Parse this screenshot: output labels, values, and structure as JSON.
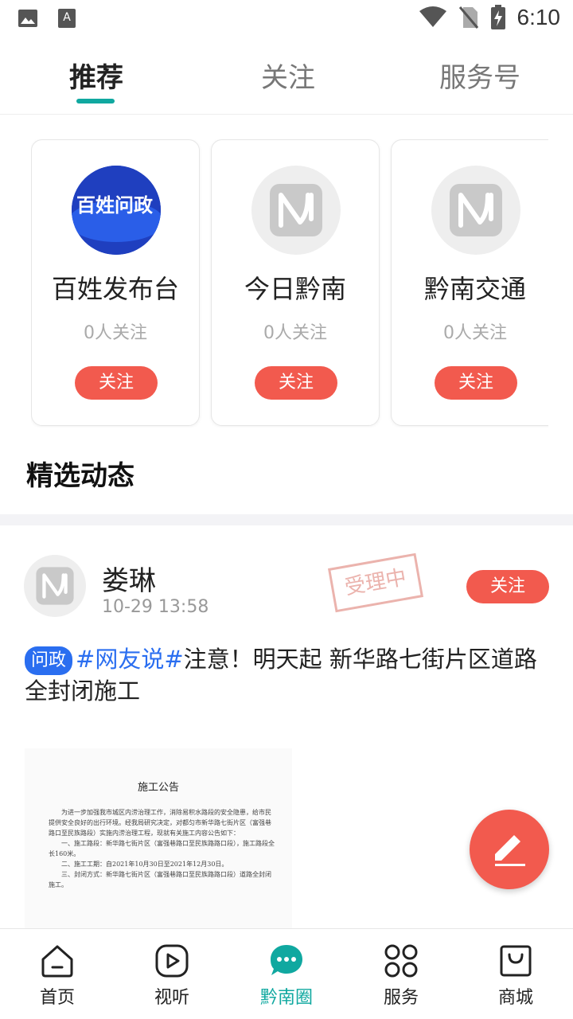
{
  "status_bar": {
    "time": "6:10"
  },
  "top_tabs": [
    {
      "label": "推荐",
      "active": true
    },
    {
      "label": "关注",
      "active": false
    },
    {
      "label": "服务号",
      "active": false
    }
  ],
  "recommend_cards": [
    {
      "name": "百姓发布台",
      "fans": "0人关注",
      "follow_label": "关注",
      "avatar_text": "百姓问政"
    },
    {
      "name": "今日黔南",
      "fans": "0人关注",
      "follow_label": "关注"
    },
    {
      "name": "黔南交通",
      "fans": "0人关注",
      "follow_label": "关注"
    }
  ],
  "section_title": "精选动态",
  "post": {
    "author": "娄琳",
    "time": "10-29 13:58",
    "stamp": "受理中",
    "follow_label": "关注",
    "tag": "问政",
    "hashtag": "#网友说#",
    "text": "注意！明天起 新华路七街片区道路全封闭施工",
    "image": {
      "title": "施工公告",
      "body": [
        "为进一步加强我市城区内涝治理工作，消除易积水路段的安全隐患，给市民提供安全良好的出行环境。经我局研究决定，对都匀市新华路七街片区（富强巷路口至民族路段）实施内涝治理工程，现就有关施工内容公告如下：",
        "一、施工路段：新华路七街片区（富强巷路口至民族路路口段），施工路段全长160米。",
        "二、施工工期：自2021年10月30日至2021年12月30日。",
        "三、封闭方式：新华路七街片区（富强巷路口至民族路路口段）道路全封闭施工。"
      ]
    }
  },
  "bottom_nav": [
    {
      "label": "首页",
      "icon": "home-icon",
      "active": false
    },
    {
      "label": "视听",
      "icon": "play-icon",
      "active": false
    },
    {
      "label": "黔南圈",
      "icon": "chat-bubble-icon",
      "active": true
    },
    {
      "label": "服务",
      "icon": "grid-icon",
      "active": false
    },
    {
      "label": "商城",
      "icon": "shopping-bag-icon",
      "active": false
    }
  ],
  "colors": {
    "accent": "#10a8a0",
    "follow_red": "#f25a4e",
    "tag_blue": "#2a6ef0"
  }
}
